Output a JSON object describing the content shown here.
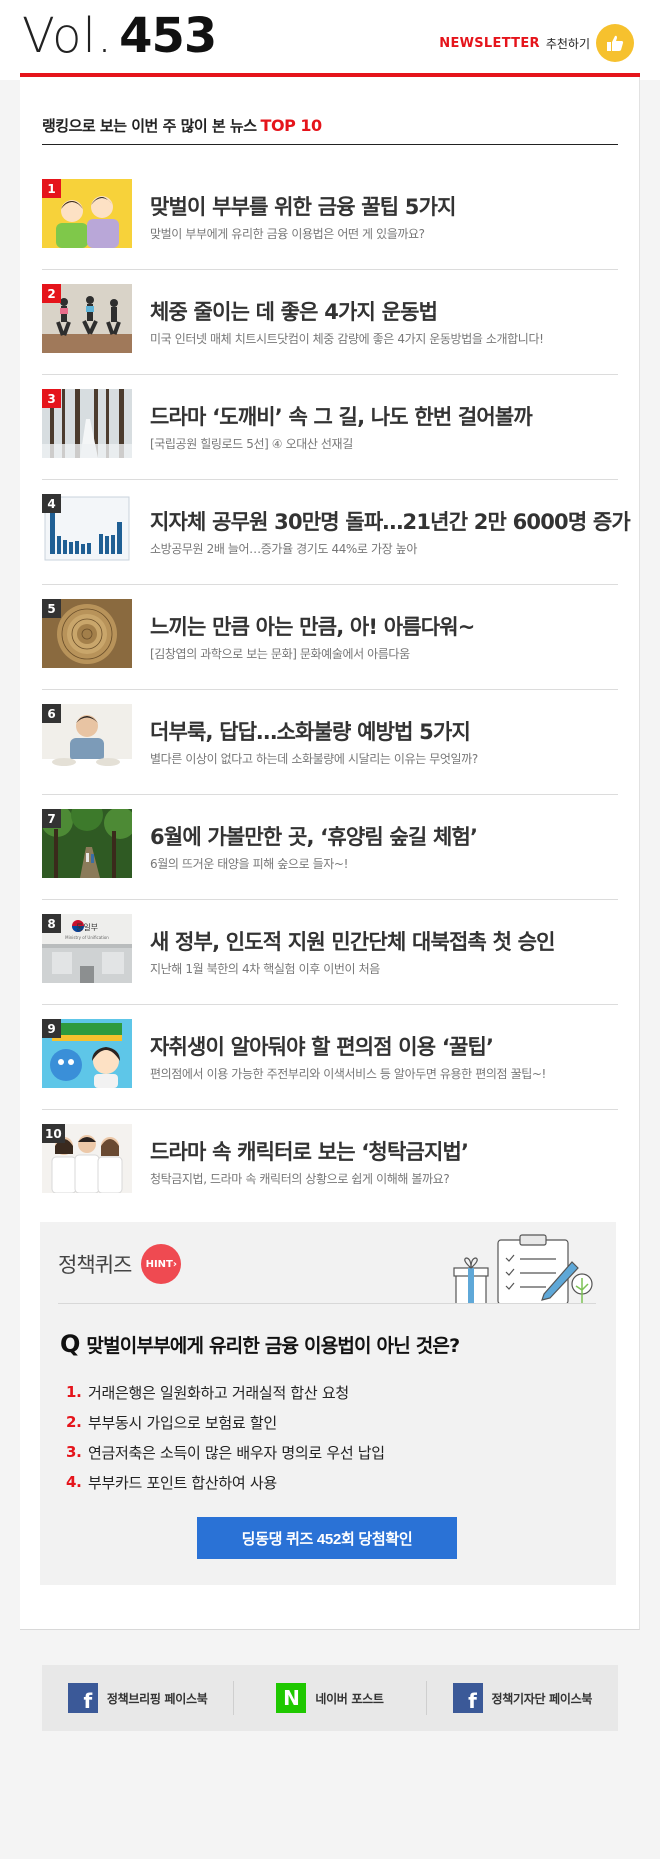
{
  "header": {
    "vol_prefix": "Vol.",
    "vol_number": "453",
    "newsletter_word": "NEWSLETTER",
    "recommend_text": "추천하기",
    "accent_color": "#e5141b"
  },
  "ranking": {
    "title_prefix": "랭킹으로 보는 이번 주 많이 본 뉴스",
    "title_top": "TOP 10",
    "items": [
      {
        "rank": "1",
        "title": "맞벌이 부부를 위한 금융 꿀팁 5가지",
        "desc": "맞벌이 부부에게 유리한 금융 이용법은 어떤 게 있을까요?"
      },
      {
        "rank": "2",
        "title": "체중 줄이는 데 좋은 4가지 운동법",
        "desc": "미국 인터넷 매체 치트시트닷컴이 체중 감량에 좋은 4가지 운동방법을 소개합니다!"
      },
      {
        "rank": "3",
        "title": "드라마 ‘도깨비’ 속 그 길, 나도 한번 걸어볼까",
        "desc": "[국립공원 힐링로드 5선] ④ 오대산 선재길"
      },
      {
        "rank": "4",
        "title": "지자체 공무원 30만명 돌파…21년간 2만 6000명 증가",
        "desc": "소방공무원 2배 늘어…증가율 경기도 44%로 가장 높아"
      },
      {
        "rank": "5",
        "title": "느끼는 만큼 아는 만큼, 아! 아름다워~",
        "desc": "[김창엽의 과학으로 보는 문화] 문화예술에서 아름다움"
      },
      {
        "rank": "6",
        "title": "더부룩, 답답…소화불량 예방법 5가지",
        "desc": "별다른 이상이 없다고 하는데 소화불량에 시달리는 이유는 무엇일까?"
      },
      {
        "rank": "7",
        "title": "6월에 가볼만한 곳, ‘휴양림 숲길 체험’",
        "desc": "6월의 뜨거운 태양을 피해 숲으로 들자~!"
      },
      {
        "rank": "8",
        "title": "새 정부, 인도적 지원 민간단체 대북접촉 첫 승인",
        "desc": "지난해 1월 북한의 4차 핵실험 이후 이번이 처음"
      },
      {
        "rank": "9",
        "title": "자취생이 알아둬야 할 편의점 이용 ‘꿀팁’",
        "desc": "편의점에서 이용 가능한 주전부리와 이색서비스 등 알아두면 유용한 편의점 꿀팁~!"
      },
      {
        "rank": "10",
        "title": "드라마 속 캐릭터로 보는 ‘청탁금지법’",
        "desc": "청탁금지법, 드라마 속 캐릭터의 상황으로 쉽게 이해해 볼까요?"
      }
    ],
    "thumb8_label": "통일부",
    "thumb8_sublabel": "Ministry of Unification"
  },
  "quiz": {
    "label": "정책퀴즈",
    "hint": "HINT",
    "q_mark": "Q",
    "question": "맞벌이부부에게 유리한 금융 이용법이 아닌 것은?",
    "options": [
      {
        "num": "1.",
        "text": "거래은행은 일원화하고 거래실적 합산 요청"
      },
      {
        "num": "2.",
        "text": "부부동시 가입으로 보험료 할인"
      },
      {
        "num": "3.",
        "text": "연금저축은 소득이 많은 배우자 명의로 우선 납입"
      },
      {
        "num": "4.",
        "text": "부부카드 포인트 합산하여 사용"
      }
    ],
    "button_label": "딩동댕 퀴즈 452회 당첨확인"
  },
  "footer": {
    "links": [
      {
        "icon": "f",
        "label": "정책브리핑 페이스북"
      },
      {
        "icon": "N",
        "label": "네이버 포스트"
      },
      {
        "icon": "f",
        "label": "정책기자단 페이스북"
      }
    ]
  }
}
